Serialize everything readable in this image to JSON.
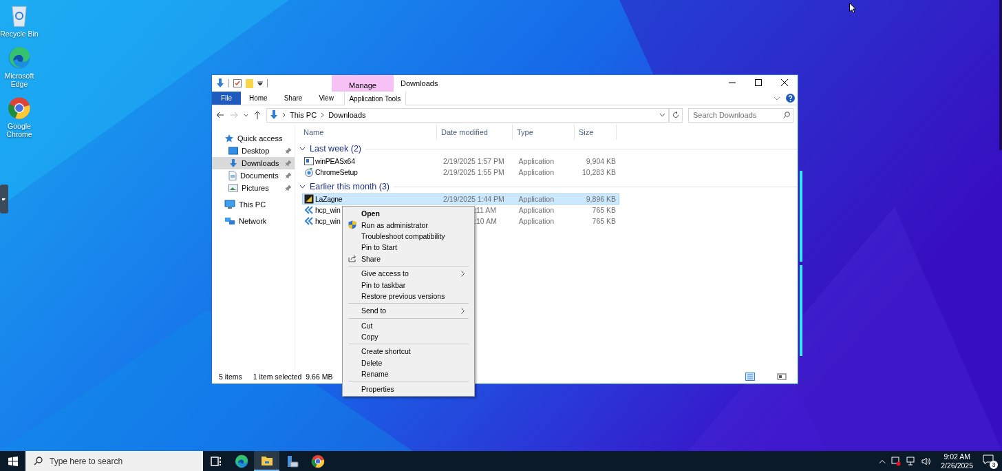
{
  "desktop_icons": [
    {
      "kind": "recycle",
      "label": "Recycle Bin"
    },
    {
      "kind": "edge",
      "label": "Microsoft Edge"
    },
    {
      "kind": "chrome",
      "label": "Google Chrome"
    }
  ],
  "explorer": {
    "title": "Downloads",
    "contextual_tab": {
      "group": "Manage",
      "label": "Application Tools"
    },
    "tabs": [
      {
        "label": "File",
        "selected": false,
        "kind": "file"
      },
      {
        "label": "Home",
        "selected": false,
        "kind": "tab"
      },
      {
        "label": "Share",
        "selected": false,
        "kind": "tab"
      },
      {
        "label": "View",
        "selected": false,
        "kind": "tab"
      }
    ],
    "breadcrumb": [
      "This PC",
      "Downloads"
    ],
    "search": {
      "placeholder": "Search Downloads"
    },
    "nav": [
      {
        "label": "Quick access",
        "kind": "star",
        "selected": false,
        "children": [
          {
            "label": "Desktop",
            "kind": "desktop",
            "selected": false,
            "pinned": true
          },
          {
            "label": "Downloads",
            "kind": "downloads",
            "selected": true,
            "pinned": true
          },
          {
            "label": "Documents",
            "kind": "documents",
            "selected": false,
            "pinned": true
          },
          {
            "label": "Pictures",
            "kind": "pictures",
            "selected": false,
            "pinned": true
          }
        ]
      },
      {
        "label": "This PC",
        "kind": "pc",
        "selected": false
      },
      {
        "label": "Network",
        "kind": "network",
        "selected": false
      }
    ],
    "columns": [
      "Name",
      "Date modified",
      "Type",
      "Size"
    ],
    "groups": [
      {
        "label": "Last week (2)",
        "items": [
          {
            "kind": "console",
            "name": "winPEASx64",
            "date": "2/19/2025 1:57 PM",
            "type": "Application",
            "size": "9,904 KB",
            "selected": false,
            "covered": false
          },
          {
            "kind": "setup",
            "name": "ChromeSetup",
            "date": "2/19/2025 1:55 PM",
            "type": "Application",
            "size": "10,283 KB",
            "selected": false,
            "covered": false
          }
        ]
      },
      {
        "label": "Earlier this month (3)",
        "items": [
          {
            "kind": "app",
            "name": "LaZagne",
            "date": "2/19/2025 1:44 PM",
            "type": "Application",
            "size": "9,896 KB",
            "selected": true,
            "covered": false
          },
          {
            "kind": "chevrons",
            "name": "hcp_win",
            "date": ":11 AM",
            "type": "Application",
            "size": "765 KB",
            "selected": false,
            "covered": true
          },
          {
            "kind": "chevrons",
            "name": "hcp_win",
            "date": ":10 AM",
            "type": "Application",
            "size": "765 KB",
            "selected": false,
            "covered": true
          }
        ]
      }
    ],
    "status": {
      "count": "5 items",
      "selection": "1 item selected  9.66 MB"
    }
  },
  "context_menu": [
    [
      {
        "label": "Open",
        "kind": "default"
      },
      {
        "label": "Run as administrator",
        "kind": "elevated"
      },
      {
        "label": "Troubleshoot compatibility",
        "kind": "plain"
      },
      {
        "label": "Pin to Start",
        "kind": "plain"
      },
      {
        "label": "Share",
        "kind": "share"
      }
    ],
    [
      {
        "label": "Give access to",
        "kind": "submenu"
      },
      {
        "label": "Pin to taskbar",
        "kind": "plain"
      },
      {
        "label": "Restore previous versions",
        "kind": "plain"
      }
    ],
    [
      {
        "label": "Send to",
        "kind": "submenu"
      }
    ],
    [
      {
        "label": "Cut",
        "kind": "plain"
      },
      {
        "label": "Copy",
        "kind": "plain"
      }
    ],
    [
      {
        "label": "Create shortcut",
        "kind": "plain"
      },
      {
        "label": "Delete",
        "kind": "plain"
      },
      {
        "label": "Rename",
        "kind": "plain"
      }
    ],
    [
      {
        "label": "Properties",
        "kind": "plain"
      }
    ]
  ],
  "taskbar": {
    "search_placeholder": "Type here to search",
    "apps": [
      {
        "kind": "taskview",
        "selected": false
      },
      {
        "kind": "edge",
        "selected": false
      },
      {
        "kind": "folder",
        "selected": true
      },
      {
        "kind": "server",
        "selected": false
      },
      {
        "kind": "chrome",
        "selected": false
      }
    ],
    "time": "9:02 AM",
    "date": "2/26/2025",
    "notifications": "3"
  }
}
